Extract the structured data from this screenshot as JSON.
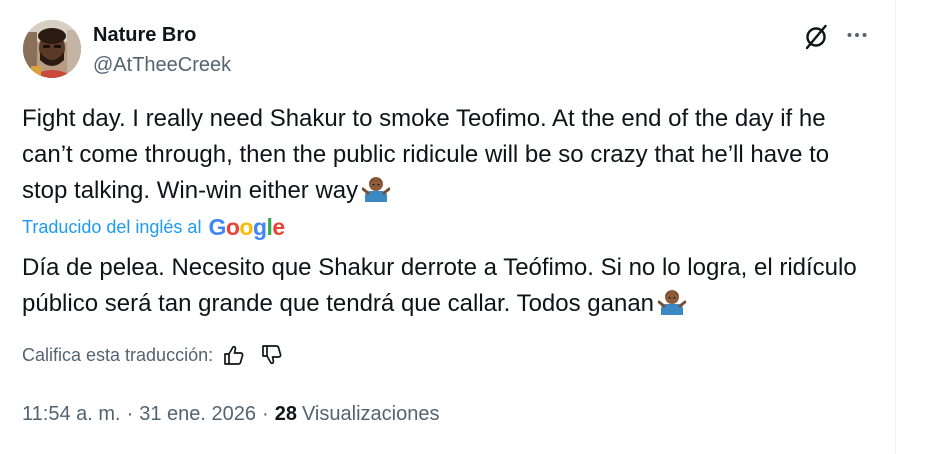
{
  "author": {
    "display_name": "Nature Bro",
    "handle": "@AtTheeCreek"
  },
  "icons": {
    "avatar": "profile-photo",
    "grok": "grok-slash-circle-icon",
    "more": "more-horizontal-icon",
    "emoji": "person-shrugging-medium-dark-skin-tone",
    "thumb_up": "thumbs-up-icon",
    "thumb_down": "thumbs-down-icon"
  },
  "tweet": {
    "text": "Fight day. I really need Shakur to smoke Teofimo. At the end of the day if he can’t come through, then the public ridicule will be so crazy that he’ll have to stop talking. Win-win either way"
  },
  "translation": {
    "label": "Traducido del inglés al",
    "provider": "Google",
    "text": "Día de pelea. Necesito que Shakur derrote a Teófimo. Si no lo logra, el ridículo público será tan grande que tendrá que callar. Todos ganan",
    "rate_label": "Califica esta traducción:"
  },
  "meta": {
    "time": "11:54 a. m.",
    "separator": "·",
    "date": "31 ene. 2026",
    "views_count": "28",
    "views_label": "Visualizaciones"
  },
  "colors": {
    "primary_text": "#0f1419",
    "secondary_text": "#536471",
    "link_blue": "#1d9bf0",
    "google_blue": "#4285f4",
    "google_red": "#ea4335",
    "google_yellow": "#fbbc05",
    "google_green": "#34a853"
  }
}
